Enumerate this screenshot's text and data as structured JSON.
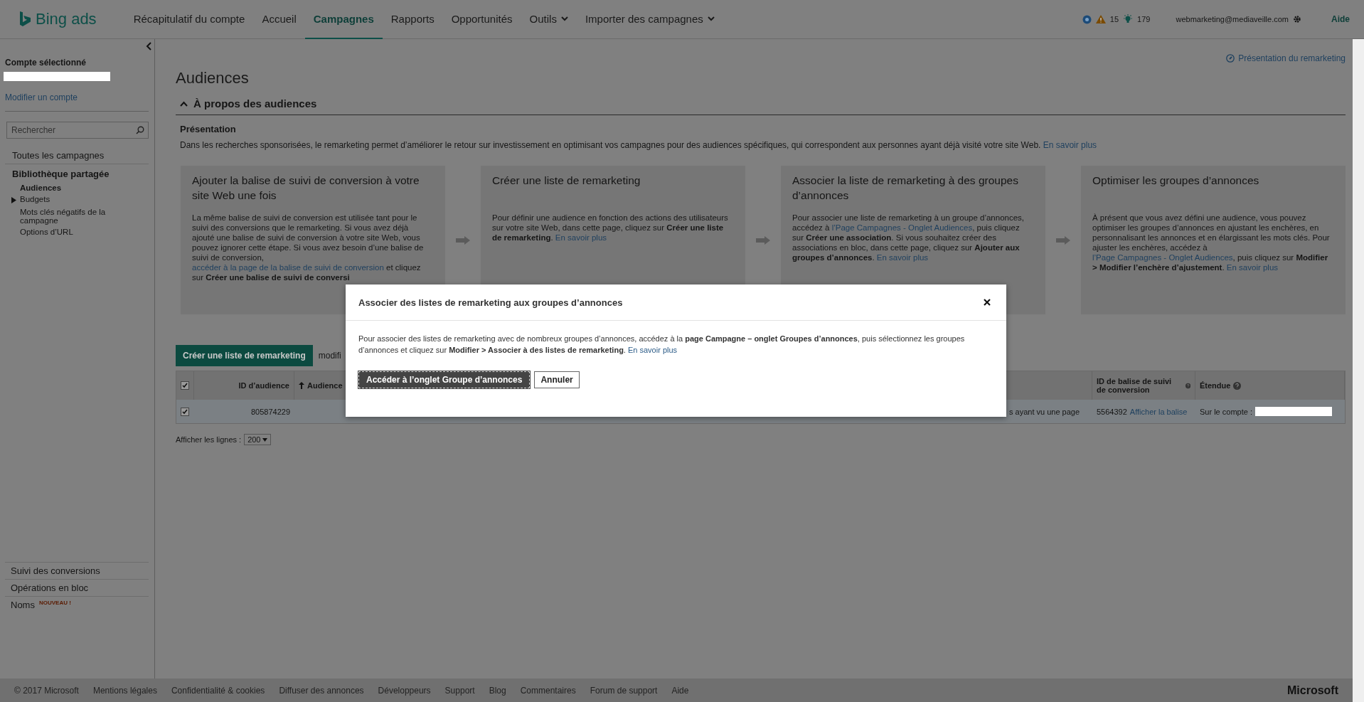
{
  "top_bar": {
    "logo": "Bing ads",
    "nav": [
      {
        "label": "Récapitulatif du compte",
        "selected": false,
        "dropdown": false
      },
      {
        "label": "Accueil",
        "selected": false,
        "dropdown": false
      },
      {
        "label": "Campagnes",
        "selected": true,
        "dropdown": false
      },
      {
        "label": "Rapports",
        "selected": false,
        "dropdown": false
      },
      {
        "label": "Opportunités",
        "selected": false,
        "dropdown": false
      },
      {
        "label": "Outils",
        "selected": false,
        "dropdown": true
      },
      {
        "label": "Importer des campagnes",
        "selected": false,
        "dropdown": true
      }
    ],
    "warnings": "15",
    "tips": "179",
    "user": "webmarketing@mediaveille.com",
    "help": "Aide"
  },
  "sidebar": {
    "account_label": "Compte sélectionné",
    "modify_link": "Modifier un compte",
    "search": {
      "placeholder": "Rechercher"
    },
    "nav": [
      {
        "label": "Toutes les campagnes",
        "kind": "link"
      },
      {
        "label": "Bibliothèque partagée",
        "kind": "section",
        "children": [
          {
            "label": "Audiences",
            "selected": true,
            "kind": "leaf"
          },
          {
            "label": "Budgets",
            "selected": false,
            "kind": "folder",
            "expanded": false
          },
          {
            "label": "Mots clés négatifs de la campagne",
            "selected": false,
            "kind": "leaf"
          },
          {
            "label": "Options d’URL",
            "selected": false,
            "kind": "leaf"
          }
        ]
      }
    ],
    "bottom": [
      {
        "label": "Suivi des conversions"
      },
      {
        "label": "Opérations en bloc"
      },
      {
        "label": "Noms",
        "badge": "NOUVEAU !"
      }
    ]
  },
  "main": {
    "overview_link": "Présentation du remarketing",
    "title": "Audiences",
    "section": {
      "title": "À propos des audiences",
      "expanded": true,
      "subtitle": "Présentation",
      "description": [
        {
          "kind": "text",
          "text": "Dans les recherches sponsorisées, le remarketing permet d’améliorer le retour sur investissement en optimisant vos campagnes pour des audiences spécifiques, qui correspondent aux personnes ayant déjà visité votre site Web. "
        },
        {
          "kind": "link",
          "text": "En savoir plus"
        }
      ],
      "cards": [
        {
          "title": "Ajouter la balise de suivi de conversion à votre site Web une fois",
          "body": [
            {
              "kind": "text",
              "text": "La même balise de suivi de conversion est utilisée tant pour le suivi des conversions que le remarketing. Si vous avez déjà ajouté une balise de suivi de conversion à votre site Web, vous pouvez ignorer cette étape. Si vous avez besoin d’une balise de suivi de conversion, "
            },
            {
              "kind": "link",
              "text": "accéder à la page de la balise de suivi de conversion"
            },
            {
              "kind": "text",
              "text": " et cliquez sur **Créer une balise de suivi de conversi**"
            }
          ]
        },
        {
          "title": "Créer une liste de remarketing",
          "body": [
            {
              "kind": "text",
              "text": "Pour définir une audience en fonction des actions des utilisateurs sur votre site Web, dans cette page, cliquez sur **Créer une liste de remarketing**. "
            },
            {
              "kind": "link",
              "text": "En savoir plus"
            }
          ]
        },
        {
          "title": "Associer la liste de remarketing à des groupes d’annonces",
          "body": [
            {
              "kind": "text",
              "text": "Pour associer une liste de remarketing à un groupe d’annonces, accédez à "
            },
            {
              "kind": "link",
              "text": "l’Page Campagnes - Onglet Audiences"
            },
            {
              "kind": "text",
              "text": ", puis cliquez sur **Créer une association**. Si vous souhaitez créer des associations en bloc, dans cette page, cliquez sur **Ajouter aux groupes d’annonces**. "
            },
            {
              "kind": "link",
              "text": "En savoir plus"
            }
          ]
        },
        {
          "title": "Optimiser les groupes d’annonces",
          "body": [
            {
              "kind": "text",
              "text": "À présent que vous avez défini une audience, vous pouvez optimiser les groupes d’annonces en ajustant les enchères, en personnalisant les annonces et en élargissant les mots clés. Pour ajuster les enchères, accédez à "
            },
            {
              "kind": "link",
              "text": "l’Page Campagnes - Onglet Audiences"
            },
            {
              "kind": "text",
              "text": ", puis cliquez sur **Modifier > Modifier l’enchère d’ajustement**. "
            },
            {
              "kind": "link",
              "text": "En savoir plus"
            }
          ]
        }
      ]
    },
    "toolbar": {
      "create_button": "Créer une liste de remarketing",
      "cut_text": "modifi"
    },
    "table": {
      "all_checked": true,
      "columns": [
        {
          "label": "ID d’audience",
          "kind": "plain"
        },
        {
          "label": "Audience",
          "kind": "sorted"
        },
        {
          "label": "ID de balise de suivi de conversion",
          "kind": "help"
        },
        {
          "label": "Étendue",
          "kind": "help"
        }
      ],
      "rows": [
        {
          "checked": true,
          "id": "805874229",
          "column_4": "s ayant vu une page",
          "tag_id": "5564392",
          "tag_link": "Afficher la balise",
          "scope": "Sur le compte :"
        }
      ]
    },
    "rows_per_page": {
      "label": "Afficher les lignes :",
      "value": "200"
    }
  },
  "dialog": {
    "title": "Associer des listes de remarketing aux groupes d’annonces",
    "body": [
      {
        "kind": "text",
        "text": "Pour associer des listes de remarketing avec de nombreux groupes d’annonces, accédez à la **page Campagne – onglet Groupes d’annonces**, puis sélectionnez les groupes d’annonces et cliquez sur **Modifier > Associer à des listes de remarketing**. "
      },
      {
        "kind": "link",
        "text": "En savoir plus"
      }
    ],
    "primary_button": "Accéder à l’onglet Groupe d’annonces",
    "cancel_button": "Annuler"
  },
  "footer": {
    "links": [
      "© 2017 Microsoft",
      "Mentions légales",
      "Confidentialité & cookies",
      "Diffuser des annonces",
      "Développeurs",
      "Support",
      "Blog",
      "Commentaires",
      "Forum de support",
      "Aide"
    ],
    "brand": "Microsoft"
  }
}
